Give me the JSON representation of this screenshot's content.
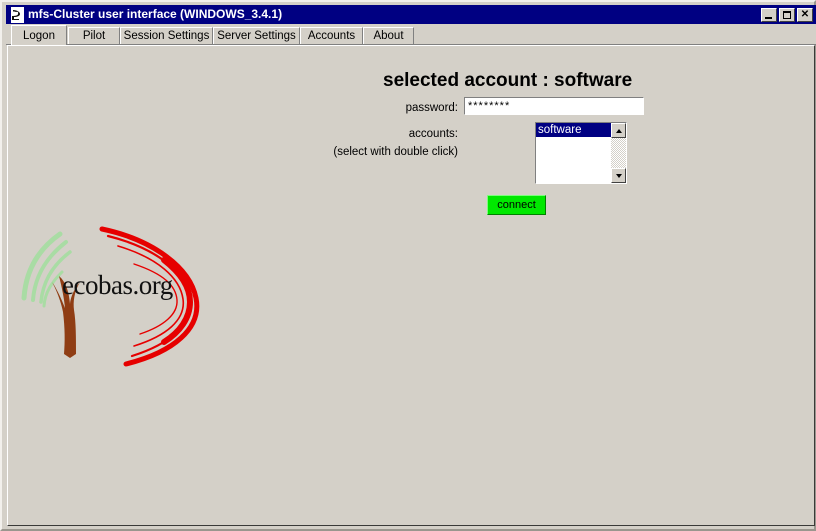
{
  "window": {
    "title": "mfs-Cluster user interface (WINDOWS_3.4.1)",
    "icon": "app-icon",
    "minimize_label": "_",
    "maximize_label": "□",
    "close_label": "✕",
    "titlebar_color": "#000082",
    "face_color": "#d4d0c8"
  },
  "tabs": [
    {
      "label": "Logon",
      "active": true
    },
    {
      "label": "Pilot",
      "active": false
    },
    {
      "label": "Session Settings",
      "active": false
    },
    {
      "label": "Server Settings",
      "active": false
    },
    {
      "label": "Accounts",
      "active": false
    },
    {
      "label": "About",
      "active": false
    }
  ],
  "logon": {
    "heading": "selected account :  software",
    "password_label": "password:",
    "password_value": "********",
    "password_placeholder": "",
    "accounts_label": "accounts:",
    "accounts_hint": "(select with double click)",
    "accounts_options": [
      "software"
    ],
    "accounts_selected": "software",
    "connect_label": "connect",
    "connect_color": "#00e800",
    "selection_color": "#000082"
  },
  "logo": {
    "text": "ecobas.org",
    "trunk_color": "#8f3d14",
    "arc_green": "#a9dca4",
    "arc_red": "#e60000"
  }
}
